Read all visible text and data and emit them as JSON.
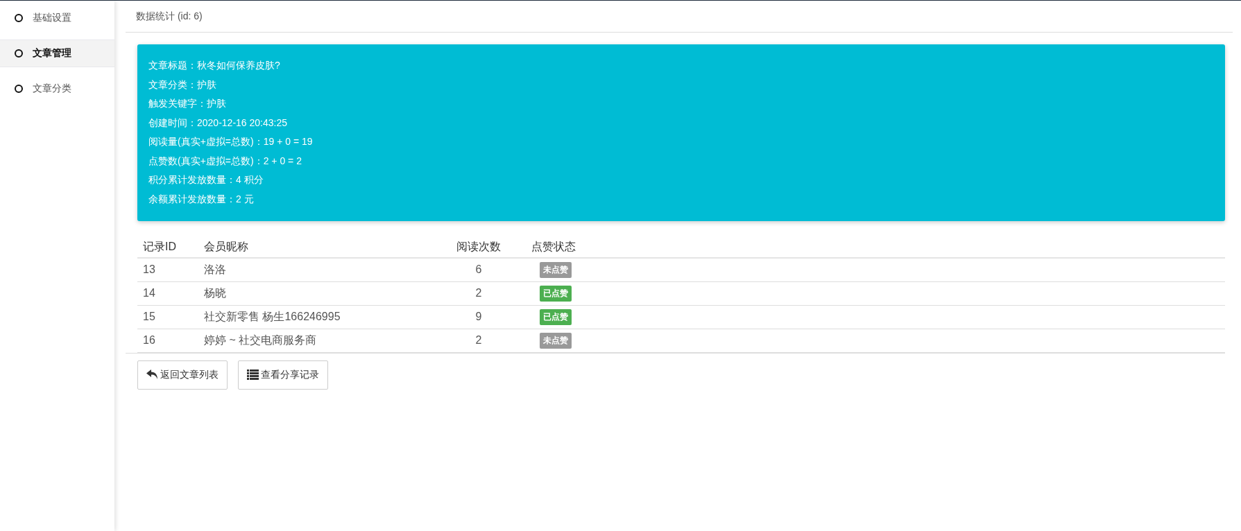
{
  "sidebar": {
    "items": [
      {
        "label": "基础设置",
        "selected": false
      },
      {
        "label": "文章管理",
        "selected": true
      },
      {
        "label": "文章分类",
        "selected": false
      }
    ]
  },
  "header": {
    "title": "数据统计 (id: 6)"
  },
  "info_card": {
    "lines": [
      "文章标题：秋冬如何保养皮肤?",
      "文章分类：护肤",
      "触发关键字：护肤",
      "创建时间：2020-12-16 20:43:25",
      "阅读量(真实+虚拟=总数)：19 + 0 = 19",
      "点赞数(真实+虚拟=总数)：2 + 0 = 2",
      "积分累计发放数量：4 积分",
      "余额累计发放数量：2 元"
    ]
  },
  "table": {
    "columns": [
      "记录ID",
      "会员昵称",
      "阅读次数",
      "点赞状态"
    ],
    "rows": [
      {
        "id": "13",
        "nickname": "洛洛",
        "reads": "6",
        "status": "未点赞",
        "liked": false
      },
      {
        "id": "14",
        "nickname": "杨晓",
        "reads": "2",
        "status": "已点赞",
        "liked": true
      },
      {
        "id": "15",
        "nickname": "社交新零售 杨生166246995",
        "reads": "9",
        "status": "已点赞",
        "liked": true
      },
      {
        "id": "16",
        "nickname": "婷婷 ~ 社交电商服务商",
        "reads": "2",
        "status": "未点赞",
        "liked": false
      }
    ]
  },
  "buttons": [
    {
      "kind": "back",
      "label": "返回文章列表"
    },
    {
      "kind": "list",
      "label": "查看分享记录"
    }
  ]
}
